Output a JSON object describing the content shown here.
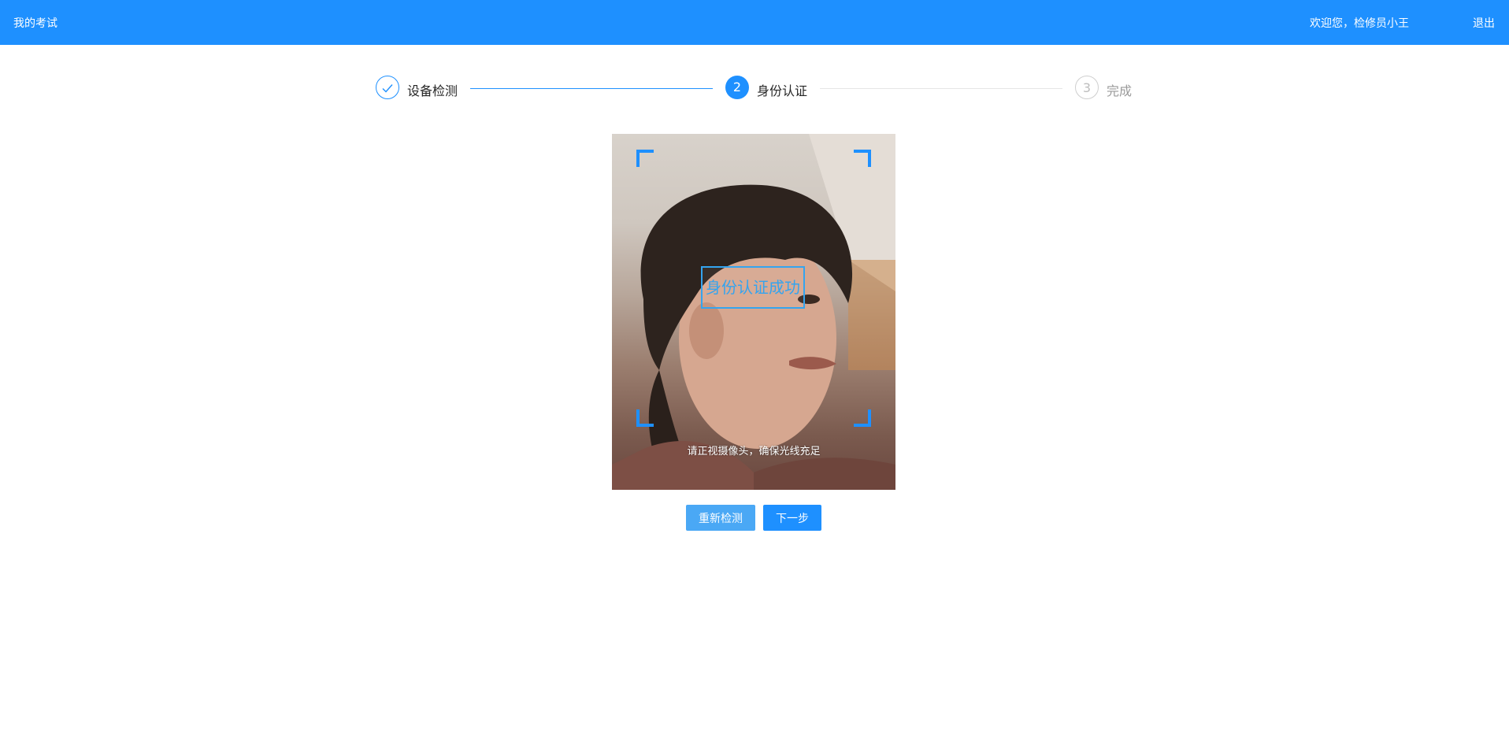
{
  "header": {
    "title": "我的考试",
    "welcome": "欢迎您，检修员小王",
    "logout": "退出"
  },
  "steps": [
    {
      "label": "设备检测",
      "status": "done",
      "icon": "check-icon"
    },
    {
      "number": "2",
      "label": "身份认证",
      "status": "active"
    },
    {
      "number": "3",
      "label": "完成",
      "status": "pending"
    }
  ],
  "camera": {
    "status_text": "身份认证成功",
    "hint": "请正视摄像头，确保光线充足"
  },
  "buttons": {
    "retry": "重新检测",
    "next": "下一步"
  },
  "colors": {
    "primary": "#1e90ff",
    "success_frame": "#34a4ef",
    "retry_button": "#4aa8f5"
  }
}
